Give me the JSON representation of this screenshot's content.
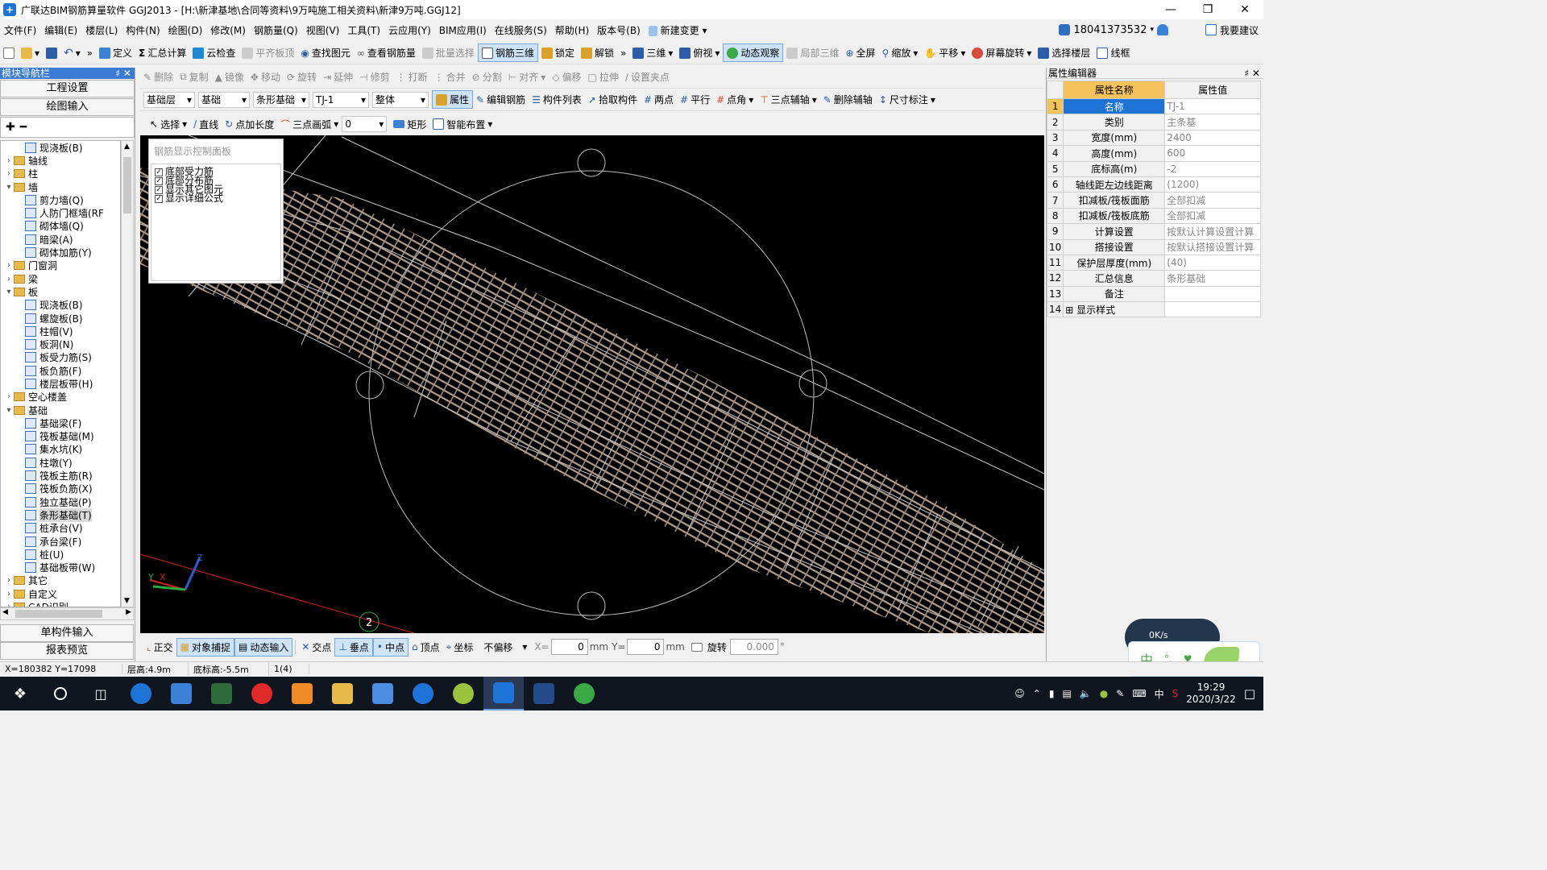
{
  "app": {
    "title": "广联达BIM钢筋算量软件 GGJ2013 - [H:\\新津基地\\合同等资料\\9万吨施工相关资料\\新津9万吨.GGJ12]"
  },
  "menu": {
    "items": [
      "文件(F)",
      "编辑(E)",
      "楼层(L)",
      "构件(N)",
      "绘图(D)",
      "修改(M)",
      "钢筋量(Q)",
      "视图(V)",
      "工具(T)",
      "云应用(Y)",
      "BIM应用(I)",
      "在线服务(S)",
      "帮助(H)",
      "版本号(B)",
      "新建变更"
    ],
    "account": "18041373532",
    "suggest": "我要建议"
  },
  "toolbar1": {
    "items": [
      "定义",
      "汇总计算",
      "云检查",
      "平齐板顶",
      "查找图元",
      "查看钢筋量",
      "批量选择",
      "钢筋三维",
      "锁定",
      "解锁",
      "三维",
      "俯视",
      "动态观察",
      "局部三维",
      "全屏",
      "缩放",
      "平移",
      "屏幕旋转",
      "选择楼层",
      "线框"
    ]
  },
  "toolbar2": {
    "items": [
      "删除",
      "复制",
      "镜像",
      "移动",
      "旋转",
      "延伸",
      "修剪",
      "打断",
      "合并",
      "分割",
      "对齐",
      "偏移",
      "拉伸",
      "设置夹点"
    ]
  },
  "toolbar3": {
    "combos": [
      "基础层",
      "基础",
      "条形基础",
      "TJ-1",
      "整体"
    ],
    "items": [
      "属性",
      "编辑钢筋",
      "构件列表",
      "拾取构件",
      "两点",
      "平行",
      "点角",
      "三点辅轴",
      "删除辅轴",
      "尺寸标注"
    ]
  },
  "toolbar4": {
    "items": [
      "选择",
      "直线",
      "点加长度",
      "三点画弧",
      "矩形",
      "智能布置"
    ],
    "arc_value": "0"
  },
  "left_panel": {
    "title": "模块导航栏",
    "btn_settings": "工程设置",
    "btn_draw": "绘图输入",
    "btn_single": "单构件输入",
    "btn_report": "报表预览",
    "tree": [
      {
        "label": "现浇板(B)",
        "level": 2,
        "type": "node"
      },
      {
        "label": "轴线",
        "level": 1,
        "type": "folder",
        "exp": "+"
      },
      {
        "label": "柱",
        "level": 1,
        "type": "folder",
        "exp": "+"
      },
      {
        "label": "墙",
        "level": 1,
        "type": "folder",
        "exp": "-"
      },
      {
        "label": "剪力墙(Q)",
        "level": 2,
        "type": "node"
      },
      {
        "label": "人防门框墙(RF",
        "level": 2,
        "type": "node"
      },
      {
        "label": "砌体墙(Q)",
        "level": 2,
        "type": "node"
      },
      {
        "label": "暗梁(A)",
        "level": 2,
        "type": "node"
      },
      {
        "label": "砌体加筋(Y)",
        "level": 2,
        "type": "node"
      },
      {
        "label": "门窗洞",
        "level": 1,
        "type": "folder",
        "exp": "+"
      },
      {
        "label": "梁",
        "level": 1,
        "type": "folder",
        "exp": "+"
      },
      {
        "label": "板",
        "level": 1,
        "type": "folder",
        "exp": "-"
      },
      {
        "label": "现浇板(B)",
        "level": 2,
        "type": "node"
      },
      {
        "label": "螺旋板(B)",
        "level": 2,
        "type": "node"
      },
      {
        "label": "柱帽(V)",
        "level": 2,
        "type": "node"
      },
      {
        "label": "板洞(N)",
        "level": 2,
        "type": "node"
      },
      {
        "label": "板受力筋(S)",
        "level": 2,
        "type": "node"
      },
      {
        "label": "板负筋(F)",
        "level": 2,
        "type": "node"
      },
      {
        "label": "楼层板带(H)",
        "level": 2,
        "type": "node"
      },
      {
        "label": "空心楼盖",
        "level": 1,
        "type": "folder",
        "exp": "+"
      },
      {
        "label": "基础",
        "level": 1,
        "type": "folder",
        "exp": "-"
      },
      {
        "label": "基础梁(F)",
        "level": 2,
        "type": "node"
      },
      {
        "label": "筏板基础(M)",
        "level": 2,
        "type": "node"
      },
      {
        "label": "集水坑(K)",
        "level": 2,
        "type": "node"
      },
      {
        "label": "柱墩(Y)",
        "level": 2,
        "type": "node"
      },
      {
        "label": "筏板主筋(R)",
        "level": 2,
        "type": "node"
      },
      {
        "label": "筏板负筋(X)",
        "level": 2,
        "type": "node"
      },
      {
        "label": "独立基础(P)",
        "level": 2,
        "type": "node"
      },
      {
        "label": "条形基础(T)",
        "level": 2,
        "type": "node",
        "selected": true
      },
      {
        "label": "桩承台(V)",
        "level": 2,
        "type": "node"
      },
      {
        "label": "承台梁(F)",
        "level": 2,
        "type": "node"
      },
      {
        "label": "桩(U)",
        "level": 2,
        "type": "node"
      },
      {
        "label": "基础板带(W)",
        "level": 2,
        "type": "node"
      },
      {
        "label": "其它",
        "level": 1,
        "type": "folder",
        "exp": "+"
      },
      {
        "label": "自定义",
        "level": 1,
        "type": "folder",
        "exp": "+"
      },
      {
        "label": "CAD识别",
        "level": 1,
        "type": "folder",
        "exp": "+"
      }
    ]
  },
  "rebar_panel": {
    "title": "钢筋显示控制面板",
    "options": [
      {
        "label": "底部受力筋",
        "checked": true
      },
      {
        "label": "底部分布筋",
        "checked": true
      },
      {
        "label": "显示其它图元",
        "checked": true
      },
      {
        "label": "显示详细公式",
        "checked": true
      }
    ]
  },
  "viewport": {
    "axis_marker": "2",
    "axis_labels": [
      "X",
      "Y",
      "Z"
    ]
  },
  "property_editor": {
    "title": "属性编辑器",
    "col_name": "属性名称",
    "col_value": "属性值",
    "rows": [
      {
        "n": "1",
        "name": "名称",
        "value": "TJ-1"
      },
      {
        "n": "2",
        "name": "类别",
        "value": "主条基"
      },
      {
        "n": "3",
        "name": "宽度(mm)",
        "value": "2400"
      },
      {
        "n": "4",
        "name": "高度(mm)",
        "value": "600"
      },
      {
        "n": "5",
        "name": "底标高(m)",
        "value": "-2"
      },
      {
        "n": "6",
        "name": "轴线距左边线距离",
        "value": "(1200)"
      },
      {
        "n": "7",
        "name": "扣减板/筏板面筋",
        "value": "全部扣减"
      },
      {
        "n": "8",
        "name": "扣减板/筏板底筋",
        "value": "全部扣减"
      },
      {
        "n": "9",
        "name": "计算设置",
        "value": "按默认计算设置计算"
      },
      {
        "n": "10",
        "name": "搭接设置",
        "value": "按默认搭接设置计算"
      },
      {
        "n": "11",
        "name": "保护层厚度(mm)",
        "value": "(40)"
      },
      {
        "n": "12",
        "name": "汇总信息",
        "value": "条形基础"
      },
      {
        "n": "13",
        "name": "备注",
        "value": ""
      },
      {
        "n": "14",
        "name": "显示样式",
        "value": ""
      }
    ]
  },
  "snap_bar": {
    "items": [
      "正交",
      "对象捕捉",
      "动态输入",
      "交点",
      "垂点",
      "中点",
      "顶点",
      "坐标"
    ],
    "offset": "不偏移",
    "x_label": "X=",
    "x_value": "0",
    "y_label": "Y=",
    "y_value": "0",
    "unit": "mm",
    "rotate_label": "旋转",
    "rotate_value": "0.000"
  },
  "status": {
    "coords": "X=180382 Y=17098",
    "floor_height": "层高:4.9m",
    "bottom_elev": "底标高:-5.5m",
    "count": "1(4)"
  },
  "ime": {
    "speed": "0K/s",
    "mode": "中"
  },
  "taskbar": {
    "time": "19:29",
    "date": "2020/3/22",
    "lang": "中"
  }
}
